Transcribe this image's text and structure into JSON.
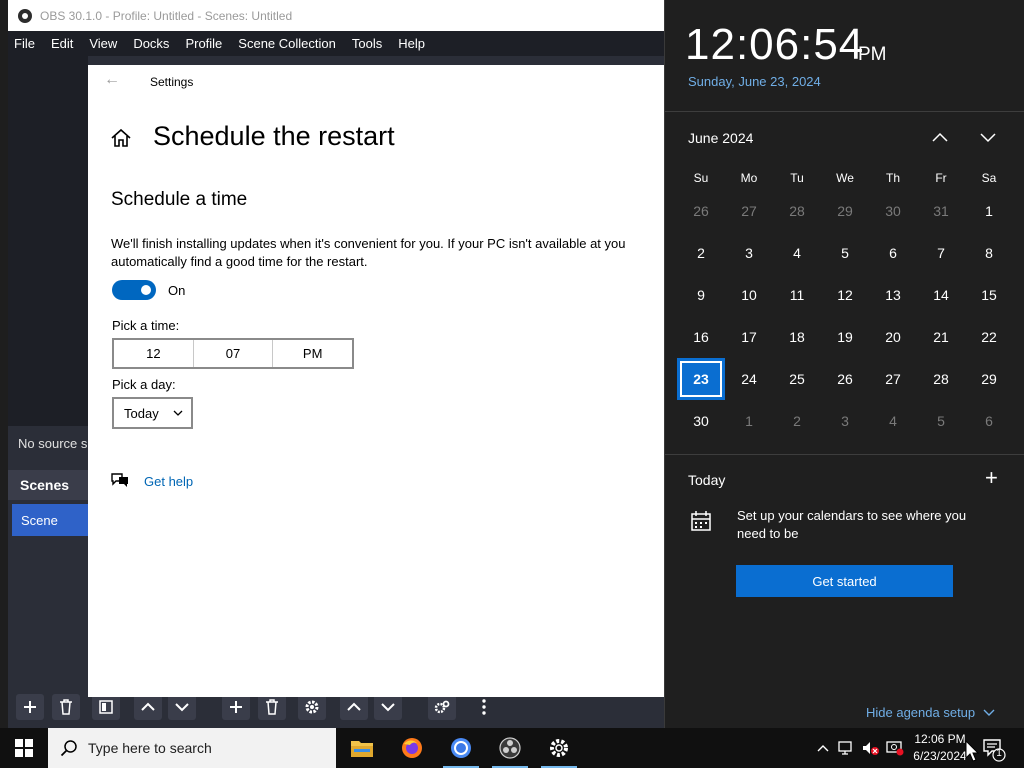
{
  "obs": {
    "title": "OBS 30.1.0 - Profile: Untitled - Scenes: Untitled",
    "menu": [
      "File",
      "Edit",
      "View",
      "Docks",
      "Profile",
      "Scene Collection",
      "Tools",
      "Help"
    ],
    "no_source": "No source s",
    "scenes_title": "Scenes",
    "scene_item": "Scene"
  },
  "settings": {
    "window_title": "Settings",
    "page_title": "Schedule the restart",
    "section_title": "Schedule a time",
    "description": "We'll finish installing updates when it's convenient for you. If your PC isn't available at you automatically find a good time for the restart.",
    "toggle_state": "On",
    "pick_time_label": "Pick a time:",
    "time": {
      "hour": "12",
      "minute": "07",
      "ampm": "PM"
    },
    "pick_day_label": "Pick a day:",
    "day_value": "Today",
    "get_help": "Get help"
  },
  "flyout": {
    "time": "12:06:54",
    "ampm": "PM",
    "date": "Sunday, June 23, 2024",
    "month": "June 2024",
    "weekdays": [
      "Su",
      "Mo",
      "Tu",
      "We",
      "Th",
      "Fr",
      "Sa"
    ],
    "weeks": [
      [
        "26",
        "27",
        "28",
        "29",
        "30",
        "31",
        "1"
      ],
      [
        "2",
        "3",
        "4",
        "5",
        "6",
        "7",
        "8"
      ],
      [
        "9",
        "10",
        "11",
        "12",
        "13",
        "14",
        "15"
      ],
      [
        "16",
        "17",
        "18",
        "19",
        "20",
        "21",
        "22"
      ],
      [
        "23",
        "24",
        "25",
        "26",
        "27",
        "28",
        "29"
      ],
      [
        "30",
        "1",
        "2",
        "3",
        "4",
        "5",
        "6"
      ]
    ],
    "agenda_title": "Today",
    "agenda_message": "Set up your calendars to see where you need to be",
    "get_started": "Get started",
    "hide_agenda": "Hide agenda setup"
  },
  "taskbar": {
    "search_placeholder": "Type here to search",
    "clock_time": "12:06 PM",
    "clock_date": "6/23/2024",
    "notification_count": "1"
  },
  "colors": {
    "accent": "#0a6ed1",
    "link": "#0066b4",
    "flyout_link": "#70aee6",
    "obs_selected": "#2f62c8"
  }
}
